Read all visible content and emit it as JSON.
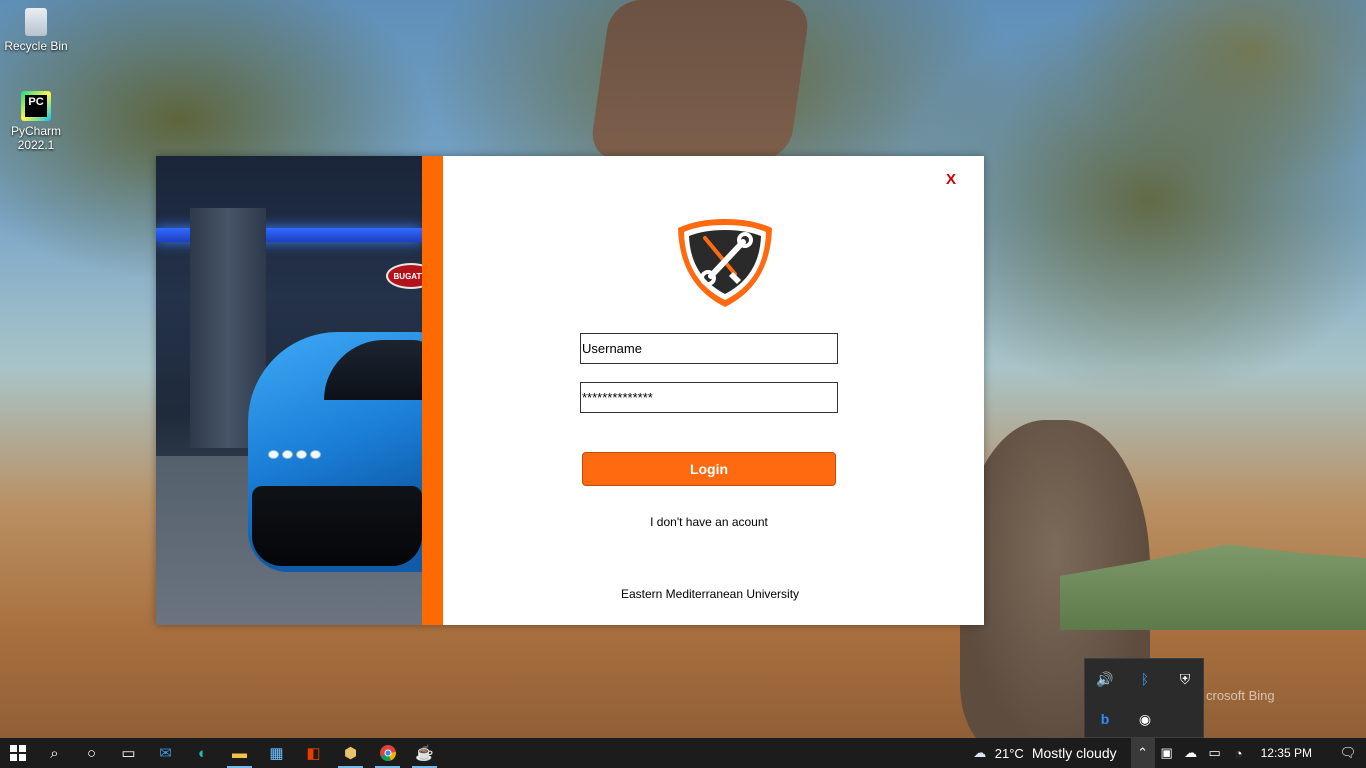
{
  "desktop": {
    "icons": [
      {
        "label": "Recycle Bin",
        "icon": "recycle-bin-icon"
      },
      {
        "label": "PyCharm\n2022.1",
        "line1": "PyCharm",
        "line2": "2022.1",
        "icon": "pycharm-icon",
        "icon_text": "PC"
      }
    ]
  },
  "login": {
    "close_label": "X",
    "logo": "mechanic-shield-logo",
    "username_value": "Username",
    "password_value": "**************",
    "login_button": "Login",
    "signup_link": "I don't have an acount",
    "footer": "Eastern Mediterranean University",
    "car_badge_text": "BUGATTI",
    "accent_color": "#ff6a00"
  },
  "tray_flyout": {
    "items": [
      "volume-icon",
      "bluetooth-icon",
      "security-shield-icon",
      "bing-icon",
      "record-icon"
    ]
  },
  "wallpaper_watermark": "crosoft Bing",
  "taskbar": {
    "apps": [
      "start-icon",
      "search-icon",
      "cortana-icon",
      "task-view-icon",
      "mail-icon",
      "edge-icon",
      "file-explorer-icon",
      "store-icon",
      "office-icon",
      "app-icon",
      "chrome-icon",
      "java-icon"
    ],
    "weather": {
      "temp": "21°C",
      "condition": "Mostly cloudy"
    },
    "clock": "12:35 PM"
  }
}
